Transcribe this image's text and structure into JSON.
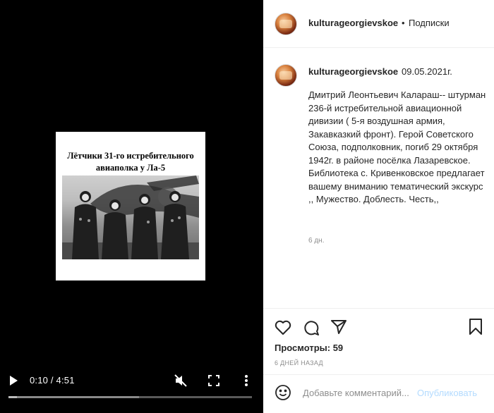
{
  "video": {
    "poster_title_line1": "Лётчики 31-го истребительного",
    "poster_title_line2": "авиаполка у Ла-5",
    "time": "0:10 / 4:51",
    "progress": 0.035
  },
  "header": {
    "username": "kulturageorgievskoe",
    "separator": "•",
    "follow_label": "Подписки"
  },
  "caption": {
    "username": "kulturageorgievskoe",
    "date": "09.05.2021г.",
    "text": "Дмитрий Леонтьевич Калараш-- штурман 236-й истребительной авиационной дивизии ( 5-я воздушная армия, Закавказкий фронт). Герой Советского Союза, подполковник, погиб 29 октября 1942г. в районе посёлка Лазаревское. Библиотека с. Кривенковское предлагает вашему вниманию тематический экскурс ,, Мужество. Доблесть. Честь,,",
    "age": "6 дн."
  },
  "actions": {
    "views": "Просмотры: 59",
    "posted": "6 ДНЕЙ НАЗАД"
  },
  "comment": {
    "placeholder": "Добавьте комментарий...",
    "publish_label": "Опубликовать"
  },
  "colors": {
    "video_bg": "#000000",
    "publish_disabled": "#b3dbff",
    "muted_text": "#8e8e8e"
  },
  "icons": [
    "play-icon",
    "volume-muted-icon",
    "fullscreen-icon",
    "more-vertical-icon",
    "heart-icon",
    "comment-icon",
    "share-icon",
    "bookmark-icon",
    "emoji-icon"
  ]
}
